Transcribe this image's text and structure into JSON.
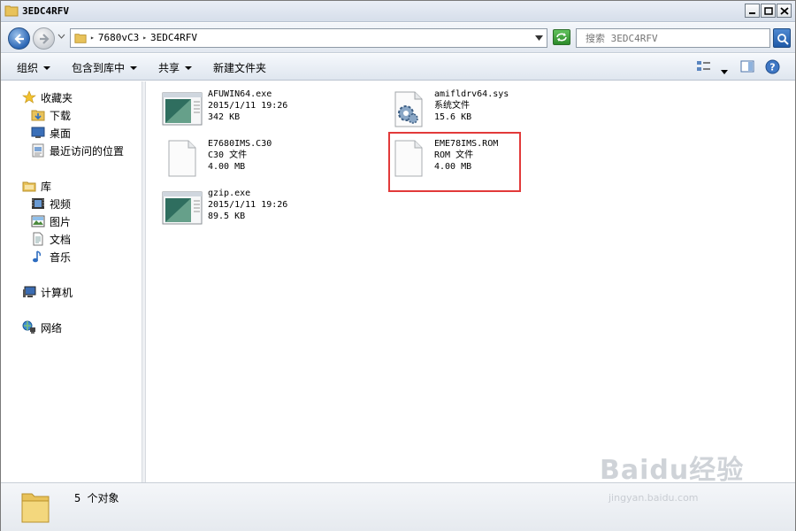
{
  "window": {
    "title": "3EDC4RFV",
    "controls": [
      "minimize-icon",
      "maximize-icon",
      "close-icon"
    ]
  },
  "address": {
    "crumbs": [
      "7680vC3",
      "3EDC4RFV"
    ],
    "search_placeholder": "搜索 3EDC4RFV"
  },
  "toolbar": {
    "organize": "组织",
    "include_in_library": "包含到库中",
    "share": "共享",
    "new_folder": "新建文件夹"
  },
  "nav": {
    "favorites": "收藏夹",
    "downloads": "下载",
    "desktop": "桌面",
    "recent": "最近访问的位置",
    "libraries": "库",
    "videos": "视频",
    "pictures": "图片",
    "documents": "文档",
    "music": "音乐",
    "computer": "计算机",
    "network": "网络"
  },
  "files": [
    {
      "name": "AFUWIN64.exe",
      "line2": "2015/1/11 19:26",
      "line3": "342 KB",
      "icon": "exe-window-icon"
    },
    {
      "name": "amifldrv64.sys",
      "line2": "系统文件",
      "line3": "15.6 KB",
      "icon": "system-file-gear-icon"
    },
    {
      "name": "E7680IMS.C30",
      "line2": "C30 文件",
      "line3": "4.00 MB",
      "icon": "blank-file-icon"
    },
    {
      "name": "EME78IMS.ROM",
      "line2": "ROM 文件",
      "line3": "4.00 MB",
      "icon": "blank-file-icon"
    },
    {
      "name": "gzip.exe",
      "line2": "2015/1/11 19:26",
      "line3": "89.5 KB",
      "icon": "exe-window-icon"
    }
  ],
  "status": {
    "count": "5 个对象"
  },
  "watermark": {
    "brand": "Baidu经验",
    "url": "jingyan.baidu.com"
  },
  "colors": {
    "highlight": "#e23a3a",
    "folder": "#e8c25a"
  }
}
